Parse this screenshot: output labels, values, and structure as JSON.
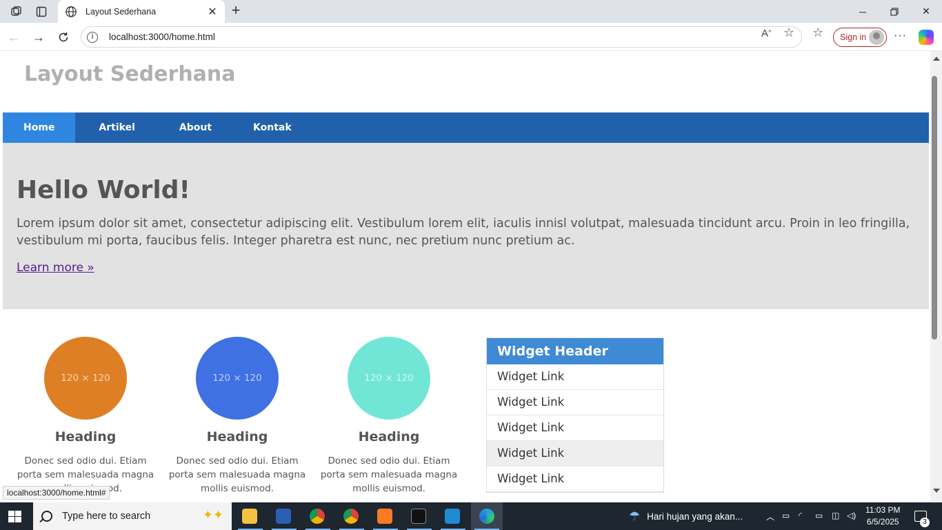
{
  "browser": {
    "tab_title": "Layout Sederhana",
    "url": "localhost:3000/home.html",
    "sign_in_label": "Sign in",
    "status_url": "localhost:3000/home.html#"
  },
  "site": {
    "title": "Layout Sederhana",
    "nav": [
      "Home",
      "Artikel",
      "About",
      "Kontak"
    ],
    "hero": {
      "heading": "Hello World!",
      "text": "Lorem ipsum dolor sit amet, consectetur adipiscing elit. Vestibulum lorem elit, iaculis innisl volutpat, malesuada tincidunt arcu. Proin in leo fringilla, vestibulum mi porta, faucibus felis. Integer pharetra est nunc, nec pretium nunc pretium ac.",
      "link": "Learn more »"
    },
    "columns": [
      {
        "placeholder": "120 × 120",
        "color": "#de7f26",
        "heading": "Heading",
        "text": "Donec sed odio dui. Etiam porta sem malesuada magna mollis euismod."
      },
      {
        "placeholder": "120 × 120",
        "color": "#3f71e2",
        "heading": "Heading",
        "text": "Donec sed odio dui. Etiam porta sem malesuada magna mollis euismod."
      },
      {
        "placeholder": "120 × 120",
        "color": "#72e6d6",
        "heading": "Heading",
        "text": "Donec sed odio dui. Etiam porta sem malesuada magna mollis euismod."
      }
    ],
    "widget": {
      "header": "Widget Header",
      "links": [
        "Widget Link",
        "Widget Link",
        "Widget Link",
        "Widget Link",
        "Widget Link"
      ]
    }
  },
  "taskbar": {
    "search_placeholder": "Type here to search",
    "weather": "Hari hujan yang akan...",
    "time": "11:03 PM",
    "date": "6/5/2025",
    "notification_count": "3"
  }
}
